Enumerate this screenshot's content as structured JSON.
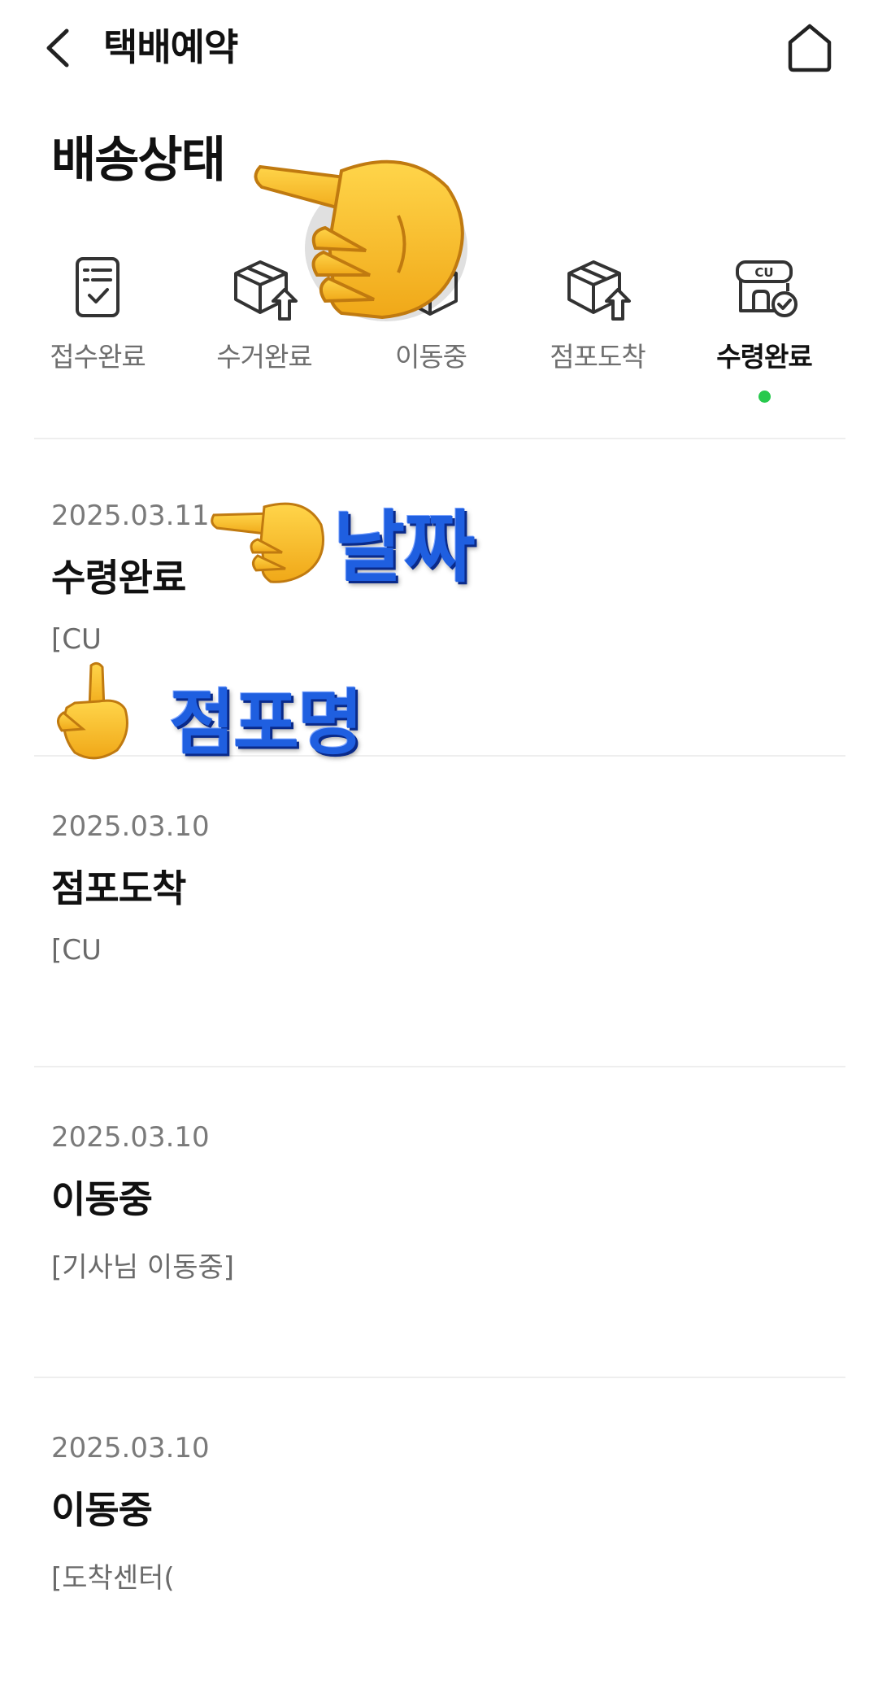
{
  "header": {
    "title": "택배예약",
    "back_icon": "chevron-left-icon",
    "home_icon": "home-icon"
  },
  "section_title": "배송상태",
  "steps": [
    {
      "label": "접수완료",
      "icon": "clipboard-check-icon",
      "active": false
    },
    {
      "label": "수거완료",
      "icon": "box-upload-icon",
      "active": false
    },
    {
      "label": "이동중",
      "icon": "box-icon",
      "active": false
    },
    {
      "label": "점포도착",
      "icon": "box-upload-icon",
      "active": false
    },
    {
      "label": "수령완료",
      "icon": "cu-store-check-icon",
      "active": true
    }
  ],
  "active_color": "#27c94d",
  "timeline": [
    {
      "date": "2025.03.11",
      "status": "수령완료",
      "detail": "[CU"
    },
    {
      "date": "2025.03.10",
      "status": "점포도착",
      "detail": "[CU"
    },
    {
      "date": "2025.03.10",
      "status": "이동중",
      "detail": "[기사님 이동중]"
    },
    {
      "date": "2025.03.10",
      "status": "이동중",
      "detail": "[도착센터("
    }
  ],
  "annotations": {
    "date_label": "날짜",
    "store_label": "점포명",
    "cu_badge": "CU",
    "pointing_icon": "pointing-hand-icon"
  }
}
